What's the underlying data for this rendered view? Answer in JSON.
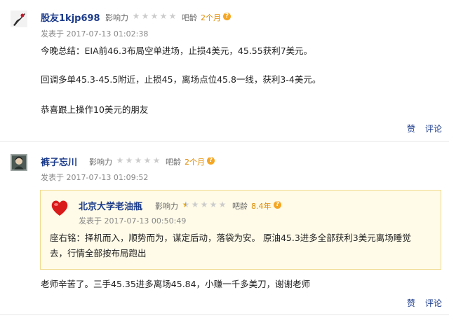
{
  "posts": [
    {
      "username": "股友1kjp698",
      "influence_label": "影响力",
      "influence_stars": 0,
      "age_label": "吧龄",
      "age_value": "2个月",
      "help_icon": "question-circle-icon",
      "time": "发表于 2017-07-13 01:02:38",
      "lines": [
        "今晚总结：EIA前46.3布局空单进场，止损4美元，45.55获利7美元。",
        "回调多单45.3-45.5附近，止损45，离场点位45.8一线，获利3-4美元。",
        "恭喜跟上操作10美元的朋友"
      ],
      "like_label": "赞",
      "comment_label": "评论"
    },
    {
      "username": "裤子忘川",
      "influence_label": "影响力",
      "influence_stars": 0,
      "age_label": "吧龄",
      "age_value": "2个月",
      "help_icon": "question-circle-icon",
      "time": "发表于 2017-07-13 01:09:52",
      "quote": {
        "username": "北京大学老油瓶",
        "avatar_icon": "red-heart-icon",
        "influence_label": "影响力",
        "influence_stars": 0.5,
        "age_label": "吧龄",
        "age_value": "8.4年",
        "time": "发表于 2017-07-13 00:50:49",
        "lines": [
          "座右铭：择机而入，顺势而为，谋定后动，落袋为安。 原油45.3进多全部获利3美元离场睡觉",
          "去，行情全部按布局跑出"
        ]
      },
      "lines": [
        "老师辛苦了。三手45.35进多离场45.84，小赚一千多美刀，谢谢老师"
      ],
      "like_label": "赞",
      "comment_label": "评论"
    }
  ]
}
